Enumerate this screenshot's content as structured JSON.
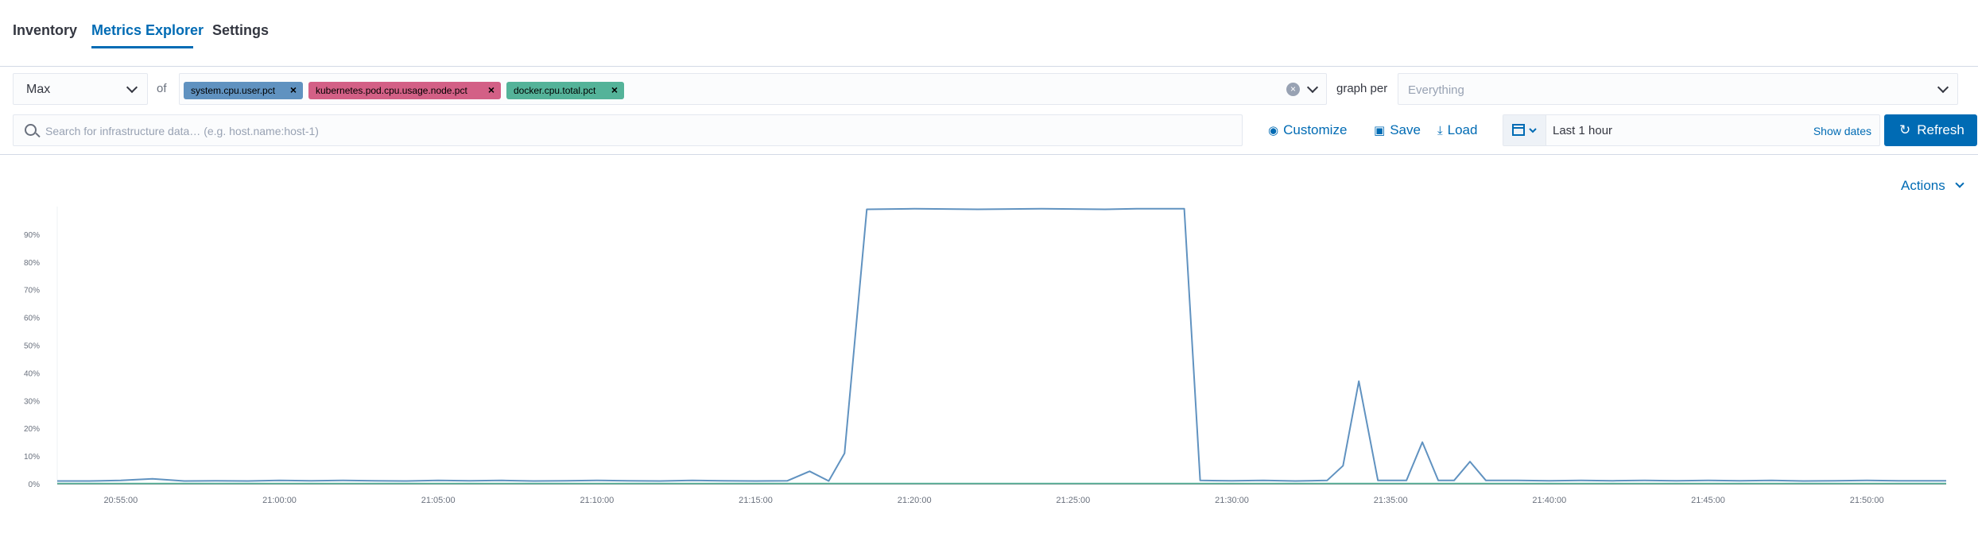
{
  "tabs": [
    {
      "label": "Inventory"
    },
    {
      "label": "Metrics Explorer"
    },
    {
      "label": "Settings"
    }
  ],
  "query": {
    "aggregation": "Max",
    "of_label": "of",
    "metrics": [
      {
        "label": "system.cpu.user.pct",
        "color": "#6092c0"
      },
      {
        "label": "kubernetes.pod.cpu.usage.node.pct",
        "color": "#d36086"
      },
      {
        "label": "docker.cpu.total.pct",
        "color": "#54b399"
      }
    ],
    "graph_per_label": "graph per",
    "group_by_placeholder": "Everything"
  },
  "toolbar": {
    "search_placeholder": "Search for infrastructure data… (e.g. host.name:host-1)",
    "customize_label": "Customize",
    "save_label": "Save",
    "load_label": "Load",
    "time_range": "Last 1 hour",
    "show_dates_label": "Show dates",
    "refresh_label": "Refresh"
  },
  "actions_label": "Actions",
  "chart_data": {
    "type": "line",
    "y_ticks": [
      "0%",
      "10%",
      "20%",
      "30%",
      "40%",
      "50%",
      "60%",
      "70%",
      "80%",
      "90%"
    ],
    "x_ticks": [
      "20:55:00",
      "21:00:00",
      "21:05:00",
      "21:10:00",
      "21:15:00",
      "21:20:00",
      "21:25:00",
      "21:30:00",
      "21:35:00",
      "21:40:00",
      "21:45:00",
      "21:50:00"
    ],
    "ylim": [
      0,
      1.0
    ],
    "xlim_minutes": [
      53.0,
      112.5
    ],
    "series": [
      {
        "name": "system.cpu.user.pct",
        "color": "#6092c0",
        "points": [
          [
            53.0,
            0.01
          ],
          [
            54.0,
            0.01
          ],
          [
            55.0,
            0.012
          ],
          [
            56.0,
            0.018
          ],
          [
            57.0,
            0.01
          ],
          [
            58.0,
            0.011
          ],
          [
            59.0,
            0.01
          ],
          [
            60.0,
            0.012
          ],
          [
            61.0,
            0.011
          ],
          [
            62.0,
            0.012
          ],
          [
            63.0,
            0.011
          ],
          [
            64.0,
            0.01
          ],
          [
            65.0,
            0.012
          ],
          [
            66.0,
            0.011
          ],
          [
            67.0,
            0.012
          ],
          [
            68.0,
            0.01
          ],
          [
            69.0,
            0.011
          ],
          [
            70.0,
            0.012
          ],
          [
            71.0,
            0.011
          ],
          [
            72.0,
            0.01
          ],
          [
            73.0,
            0.012
          ],
          [
            74.0,
            0.011
          ],
          [
            75.0,
            0.01
          ],
          [
            76.0,
            0.011
          ],
          [
            76.7,
            0.045
          ],
          [
            77.3,
            0.01
          ],
          [
            77.8,
            0.11
          ],
          [
            78.5,
            0.99
          ],
          [
            80.0,
            0.992
          ],
          [
            82.0,
            0.99
          ],
          [
            84.0,
            0.992
          ],
          [
            86.0,
            0.99
          ],
          [
            87.0,
            0.992
          ],
          [
            88.5,
            0.992
          ],
          [
            89.0,
            0.012
          ],
          [
            90.0,
            0.011
          ],
          [
            91.0,
            0.012
          ],
          [
            92.0,
            0.01
          ],
          [
            93.0,
            0.012
          ],
          [
            93.5,
            0.065
          ],
          [
            94.0,
            0.37
          ],
          [
            94.6,
            0.012
          ],
          [
            95.5,
            0.012
          ],
          [
            96.0,
            0.15
          ],
          [
            96.5,
            0.012
          ],
          [
            97.0,
            0.012
          ],
          [
            97.5,
            0.08
          ],
          [
            98.0,
            0.012
          ],
          [
            99.0,
            0.012
          ],
          [
            100.0,
            0.011
          ],
          [
            101.0,
            0.012
          ],
          [
            102.0,
            0.011
          ],
          [
            103.0,
            0.012
          ],
          [
            104.0,
            0.011
          ],
          [
            105.0,
            0.012
          ],
          [
            106.0,
            0.011
          ],
          [
            107.0,
            0.012
          ],
          [
            108.0,
            0.01
          ],
          [
            109.0,
            0.011
          ],
          [
            110.0,
            0.012
          ],
          [
            111.0,
            0.011
          ],
          [
            112.5,
            0.011
          ]
        ]
      },
      {
        "name": "kubernetes.pod.cpu.usage.node.pct",
        "color": "#d36086",
        "points": [
          [
            53.0,
            0.0
          ],
          [
            112.5,
            0.0
          ]
        ]
      },
      {
        "name": "docker.cpu.total.pct",
        "color": "#54b399",
        "points": [
          [
            53.0,
            0.001
          ],
          [
            112.5,
            0.001
          ]
        ]
      }
    ]
  }
}
